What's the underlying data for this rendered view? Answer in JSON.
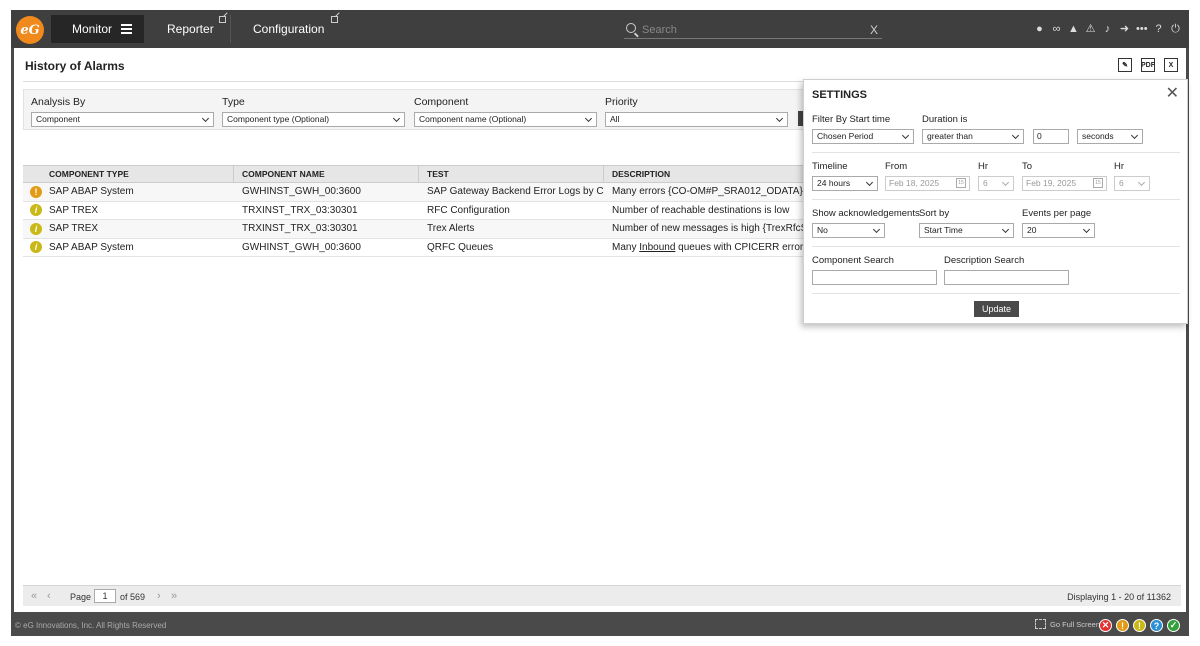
{
  "nav": {
    "logo_text": "eG",
    "monitor": "Monitor",
    "reporter": "Reporter",
    "configuration": "Configuration",
    "search_placeholder": "Search",
    "search_clear": "X",
    "icons": [
      "user-icon",
      "link-icon",
      "image-icon",
      "alert-icon",
      "bell-icon",
      "signin-icon",
      "more-icon",
      "help-icon",
      "power-icon"
    ]
  },
  "page": {
    "title": "History of Alarms",
    "tool_icons": [
      "edit-icon",
      "pdf-icon",
      "excel-icon"
    ]
  },
  "filters": {
    "analysis_label": "Analysis By",
    "analysis_value": "Component",
    "type_label": "Type",
    "type_value": "Component type (Optional)",
    "component_label": "Component",
    "component_value": "Component name (Optional)",
    "priority_label": "Priority",
    "priority_value": "All"
  },
  "table": {
    "columns": [
      "COMPONENT TYPE",
      "COMPONENT NAME",
      "TEST",
      "DESCRIPTION"
    ],
    "rows": [
      {
        "severity": "major",
        "type": "SAP ABAP System",
        "name": "GWHINST_GWH_00:3600",
        "test": "SAP Gateway Backend Error Logs by Com...",
        "desc_prefix": "Many errors {CO-OM#P_SRA012_ODATA}",
        "desc_link": "",
        "desc_suffix": ""
      },
      {
        "severity": "minor",
        "type": "SAP TREX",
        "name": "TRXINST_TRX_03:30301",
        "test": "RFC Configuration",
        "desc_prefix": "Number of reachable destinations is low",
        "desc_link": "",
        "desc_suffix": ""
      },
      {
        "severity": "minor",
        "type": "SAP TREX",
        "name": "TRXINST_TRX_03:30301",
        "test": "Trex Alerts",
        "desc_prefix": "Number of new messages is high {TrexRfcServer/",
        "desc_link": "",
        "desc_suffix": ""
      },
      {
        "severity": "minor",
        "type": "SAP ABAP System",
        "name": "GWHINST_GWH_00:3600",
        "test": "QRFC Queues",
        "desc_prefix": "Many ",
        "desc_link": "Inbound",
        "desc_suffix": " queues with CPICERR errors on SA"
      }
    ]
  },
  "pager": {
    "page_label": "Page",
    "page_value": "1",
    "of_label": "of 569",
    "displaying": "Displaying 1 - 20 of 11362"
  },
  "footer": {
    "copyright": "© eG Innovations, Inc. All Rights Reserved",
    "fullscreen": "Go Full Screen",
    "status_colors": {
      "critical": "#e53030",
      "major": "#e39a14",
      "minor": "#c9b815",
      "unknown": "#2b8fd6",
      "normal": "#35a13c"
    }
  },
  "settings": {
    "title": "SETTINGS",
    "close": "✕",
    "filter_label": "Filter By Start time",
    "filter_value": "Chosen Period",
    "duration_label": "Duration is",
    "duration_value": "greater than",
    "duration_number": "0",
    "duration_unit": "seconds",
    "timeline_label": "Timeline",
    "timeline_value": "24 hours",
    "from_label": "From",
    "from_date": "Feb 18, 2025",
    "hr_label": "Hr",
    "from_hr": "6",
    "to_label": "To",
    "to_date": "Feb 19, 2025",
    "to_hr": "6",
    "ack_label": "Show acknowledgements",
    "ack_value": "No",
    "sort_label": "Sort by",
    "sort_value": "Start Time",
    "events_label": "Events per page",
    "events_value": "20",
    "comp_search_label": "Component Search",
    "desc_search_label": "Description Search",
    "update": "Update"
  }
}
